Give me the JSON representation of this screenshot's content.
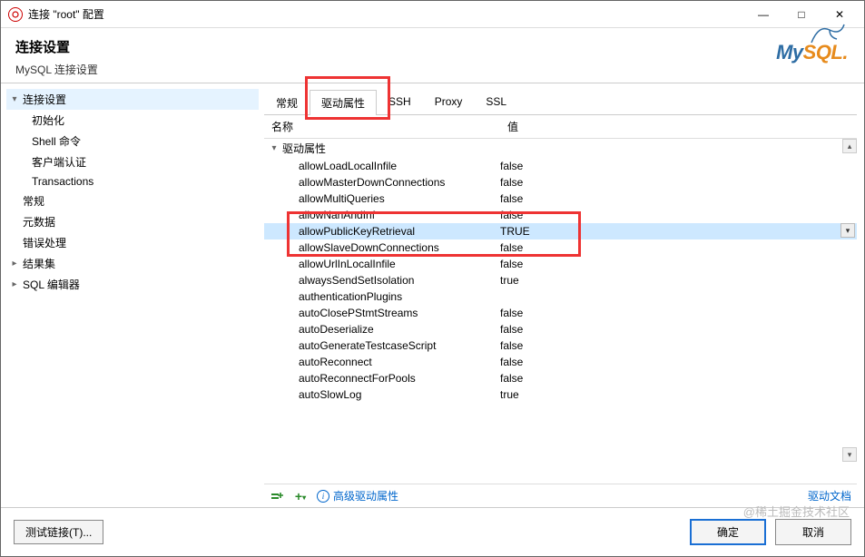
{
  "window": {
    "title": "连接 \"root\" 配置",
    "controls": {
      "min": "—",
      "max": "□",
      "close": "✕"
    }
  },
  "header": {
    "title": "连接设置",
    "subtitle": "MySQL 连接设置",
    "logo_text_1": "My",
    "logo_text_2": "SQL"
  },
  "sidebar": {
    "items": [
      {
        "label": "连接设置",
        "level": 0,
        "expandable": true,
        "expanded": true,
        "active": true
      },
      {
        "label": "初始化",
        "level": 1
      },
      {
        "label": "Shell 命令",
        "level": 1
      },
      {
        "label": "客户端认证",
        "level": 1
      },
      {
        "label": "Transactions",
        "level": 1
      },
      {
        "label": "常规",
        "level": 0
      },
      {
        "label": "元数据",
        "level": 0
      },
      {
        "label": "错误处理",
        "level": 0
      },
      {
        "label": "结果集",
        "level": 0,
        "expandable": true,
        "expanded": false
      },
      {
        "label": "SQL 编辑器",
        "level": 0,
        "expandable": true,
        "expanded": false
      }
    ]
  },
  "tabs": {
    "items": [
      {
        "label": "常规"
      },
      {
        "label": "驱动属性",
        "active": true
      },
      {
        "label": "SSH"
      },
      {
        "label": "Proxy"
      },
      {
        "label": "SSL"
      }
    ]
  },
  "grid": {
    "col_name": "名称",
    "col_value": "值",
    "group": "驱动属性",
    "rows": [
      {
        "name": "allowLoadLocalInfile",
        "value": "false"
      },
      {
        "name": "allowMasterDownConnections",
        "value": "false"
      },
      {
        "name": "allowMultiQueries",
        "value": "false"
      },
      {
        "name": "allowNanAndInf",
        "value": "false"
      },
      {
        "name": "allowPublicKeyRetrieval",
        "value": "TRUE",
        "selected": true
      },
      {
        "name": "allowSlaveDownConnections",
        "value": "false"
      },
      {
        "name": "allowUrlInLocalInfile",
        "value": "false"
      },
      {
        "name": "alwaysSendSetIsolation",
        "value": "true"
      },
      {
        "name": "authenticationPlugins",
        "value": ""
      },
      {
        "name": "autoClosePStmtStreams",
        "value": "false"
      },
      {
        "name": "autoDeserialize",
        "value": "false"
      },
      {
        "name": "autoGenerateTestcaseScript",
        "value": "false"
      },
      {
        "name": "autoReconnect",
        "value": "false"
      },
      {
        "name": "autoReconnectForPools",
        "value": "false"
      },
      {
        "name": "autoSlowLog",
        "value": "true"
      }
    ]
  },
  "toolbar": {
    "advanced": "高级驱动属性",
    "doc_link": "驱动文档"
  },
  "footer": {
    "test": "测试链接(T)...",
    "ok": "确定",
    "cancel": "取消"
  },
  "watermark": "@稀土掘金技术社区"
}
